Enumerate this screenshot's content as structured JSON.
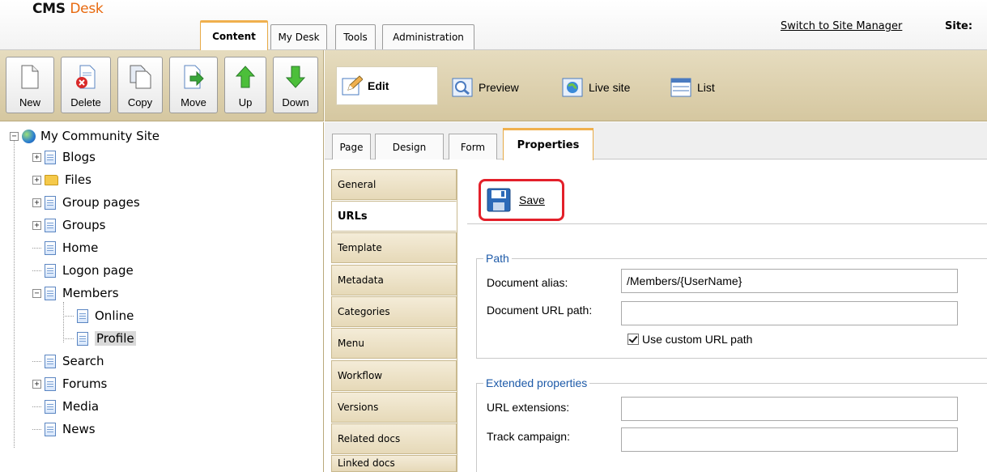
{
  "app": {
    "logo_bold": "CMS",
    "logo_light": "Desk"
  },
  "top_tabs": [
    {
      "label": "Content",
      "active": true
    },
    {
      "label": "My Desk"
    },
    {
      "label": "Tools"
    },
    {
      "label": "Administration"
    }
  ],
  "header": {
    "switch_link": "Switch to Site Manager",
    "site_label": "Site:"
  },
  "toolbar": {
    "new": "New",
    "delete": "Delete",
    "copy": "Copy",
    "move": "Move",
    "up": "Up",
    "down": "Down"
  },
  "view_modes": {
    "edit": "Edit",
    "preview": "Preview",
    "live_site": "Live site",
    "list": "List"
  },
  "tree": {
    "root": "My Community Site",
    "items": [
      {
        "label": "Blogs"
      },
      {
        "label": "Files"
      },
      {
        "label": "Group pages"
      },
      {
        "label": "Groups"
      },
      {
        "label": "Home"
      },
      {
        "label": "Logon page"
      },
      {
        "label": "Members"
      },
      {
        "label": "Online"
      },
      {
        "label": "Profile",
        "selected": true
      },
      {
        "label": "Search"
      },
      {
        "label": "Forums"
      },
      {
        "label": "Media"
      },
      {
        "label": "News"
      }
    ]
  },
  "sub_tabs": [
    {
      "label": "Page"
    },
    {
      "label": "Design"
    },
    {
      "label": "Form"
    },
    {
      "label": "Properties",
      "active": true
    }
  ],
  "property_tabs": [
    {
      "label": "General"
    },
    {
      "label": "URLs",
      "active": true
    },
    {
      "label": "Template"
    },
    {
      "label": "Metadata"
    },
    {
      "label": "Categories"
    },
    {
      "label": "Menu"
    },
    {
      "label": "Workflow"
    },
    {
      "label": "Versions"
    },
    {
      "label": "Related docs"
    },
    {
      "label": "Linked docs"
    }
  ],
  "save": {
    "label": "Save"
  },
  "path_group": {
    "legend": "Path",
    "alias_label": "Document alias:",
    "alias_value": "/Members/{UserName}",
    "url_path_label": "Document URL path:",
    "url_path_value": "",
    "custom_url_label": "Use custom URL path",
    "custom_url_checked": true
  },
  "extended_group": {
    "legend": "Extended properties",
    "url_ext_label": "URL extensions:",
    "url_ext_value": "",
    "track_label": "Track campaign:",
    "track_value": ""
  },
  "colors": {
    "accent_orange": "#e8690e",
    "highlight_red": "#e3202a",
    "legend_blue": "#1d5aa8",
    "toolbar_beige": "#e0d4b0"
  }
}
